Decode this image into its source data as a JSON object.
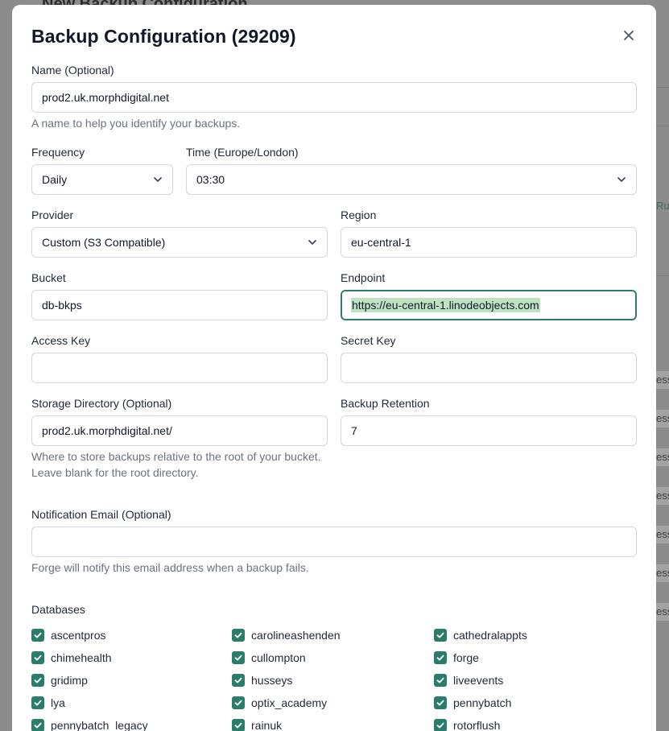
{
  "background": {
    "heading": "New Backup Configuration",
    "right_link": "Ru",
    "right_tab_text": "ess"
  },
  "modal": {
    "title": "Backup Configuration (29209)",
    "name": {
      "label": "Name (Optional)",
      "value": "prod2.uk.morphdigital.net",
      "help": "A name to help you identify your backups."
    },
    "frequency": {
      "label": "Frequency",
      "value": "Daily"
    },
    "time": {
      "label": "Time (Europe/London)",
      "value": "03:30"
    },
    "provider": {
      "label": "Provider",
      "value": "Custom (S3 Compatible)"
    },
    "region": {
      "label": "Region",
      "value": "eu-central-1"
    },
    "bucket": {
      "label": "Bucket",
      "value": "db-bkps"
    },
    "endpoint": {
      "label": "Endpoint",
      "value": "https://eu-central-1.linodeobjects.com"
    },
    "access_key": {
      "label": "Access Key",
      "value": ""
    },
    "secret_key": {
      "label": "Secret Key",
      "value": ""
    },
    "storage_dir": {
      "label": "Storage Directory (Optional)",
      "value": "prod2.uk.morphdigital.net/",
      "help_line1": "Where to store backups relative to the root of your bucket.",
      "help_line2": "Leave blank for the root directory."
    },
    "retention": {
      "label": "Backup Retention",
      "value": "7"
    },
    "notification": {
      "label": "Notification Email (Optional)",
      "value": "",
      "help": "Forge will notify this email address when a backup fails."
    },
    "databases": {
      "label": "Databases",
      "items": [
        {
          "name": "ascentpros",
          "checked": true
        },
        {
          "name": "carolineashenden",
          "checked": true
        },
        {
          "name": "cathedralappts",
          "checked": true
        },
        {
          "name": "chimehealth",
          "checked": true
        },
        {
          "name": "cullompton",
          "checked": true
        },
        {
          "name": "forge",
          "checked": true
        },
        {
          "name": "gridimp",
          "checked": true
        },
        {
          "name": "husseys",
          "checked": true
        },
        {
          "name": "liveevents",
          "checked": true
        },
        {
          "name": "lya",
          "checked": true
        },
        {
          "name": "optix_academy",
          "checked": true
        },
        {
          "name": "pennybatch",
          "checked": true
        },
        {
          "name": "pennybatch_legacy",
          "checked": true
        },
        {
          "name": "rainuk",
          "checked": true
        },
        {
          "name": "rotorflush",
          "checked": true
        }
      ]
    }
  },
  "colors": {
    "accent": "#2a7d6a",
    "focus_border": "#2f7d6d",
    "selection": "#bfe3c2",
    "overlay": "#8c8c8c"
  }
}
